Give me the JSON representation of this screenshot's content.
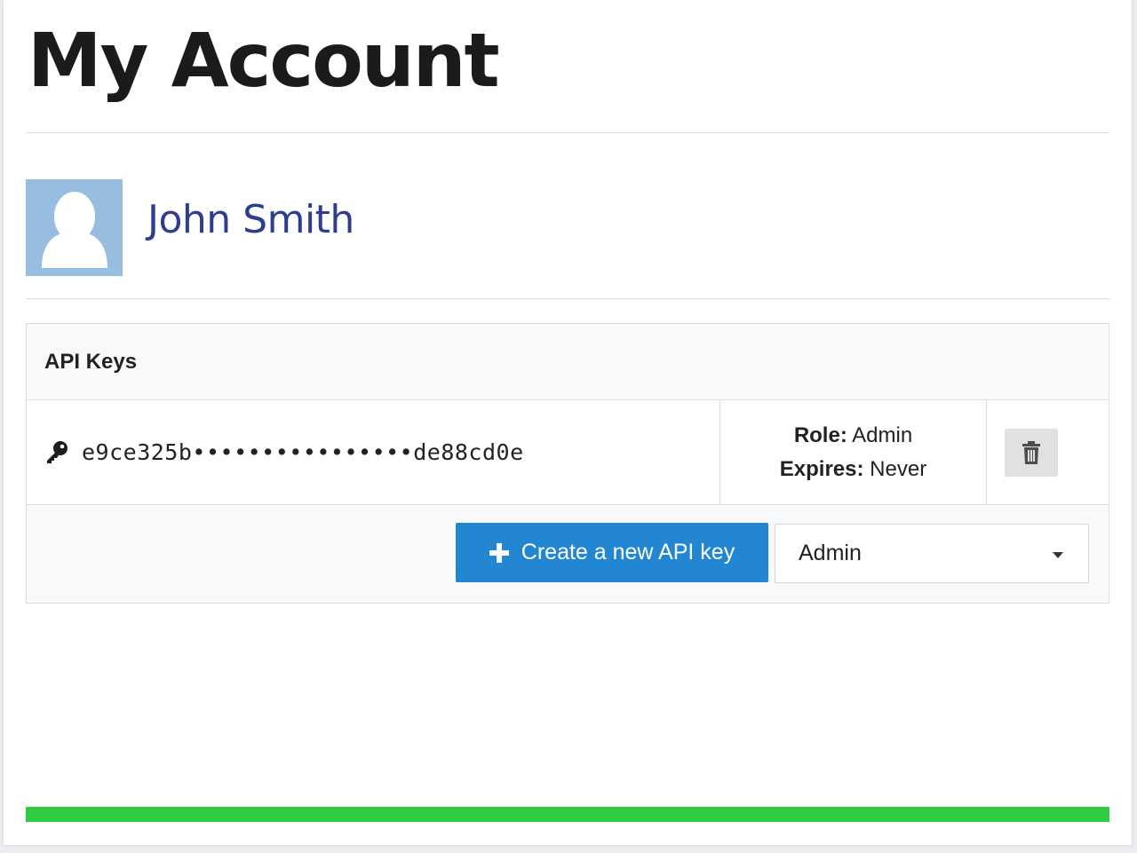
{
  "page": {
    "title": "My Account"
  },
  "user": {
    "name": "John Smith",
    "avatar_icon": "user-silhouette-icon",
    "avatar_bg": "#97bde0"
  },
  "api_keys": {
    "title": "API Keys",
    "keys": [
      {
        "icon": "key-icon",
        "value": "e9ce325b••••••••••••••••de88cd0e",
        "role_label": "Role:",
        "role": "Admin",
        "expires_label": "Expires:",
        "expires": "Never",
        "delete_icon": "trash-icon"
      }
    ],
    "create_button_label": "Create a new API key",
    "role_select": {
      "selected": "Admin"
    }
  },
  "progress": {
    "fraction": 1.0,
    "color": "#2ecc40"
  },
  "colors": {
    "accent": "#2286d3",
    "title_name": "#2e3d8f"
  }
}
